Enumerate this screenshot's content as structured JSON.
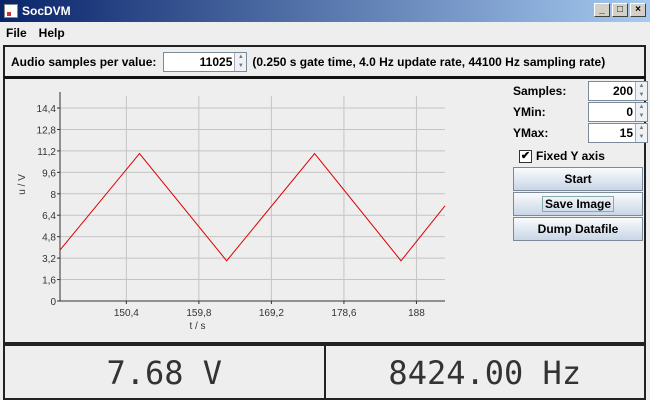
{
  "window": {
    "title": "SocDVM"
  },
  "menu": [
    "File",
    "Help"
  ],
  "top": {
    "label": "Audio samples per value:",
    "value": "11025",
    "info": "(0.250 s gate time, 4.0 Hz update rate, 44100 Hz sampling rate)"
  },
  "side": {
    "samples_label": "Samples:",
    "samples": "200",
    "ymin_label": "YMin:",
    "ymin": "0",
    "ymax_label": "YMax:",
    "ymax": "15",
    "fixed_label": "Fixed Y axis",
    "fixed_checked": true,
    "start": "Start",
    "save": "Save Image",
    "dump": "Dump Datafile"
  },
  "display": {
    "voltage": "7.68 V",
    "frequency": "8424.00 Hz"
  },
  "chart_data": {
    "type": "line",
    "xlabel": "t / s",
    "ylabel": "u / V",
    "xlim": [
      141.8,
      191.7
    ],
    "ylim": [
      0,
      15
    ],
    "xticks": [
      "150,4",
      "159,8",
      "169,2",
      "178,6",
      "188"
    ],
    "xtick_values": [
      150.4,
      159.8,
      169.2,
      178.6,
      188
    ],
    "yticks": [
      "0",
      "1,6",
      "3,2",
      "4,8",
      "6,4",
      "8",
      "9,6",
      "11,2",
      "12,8",
      "14,4"
    ],
    "ytick_values": [
      0,
      1.6,
      3.2,
      4.8,
      6.4,
      8,
      9.6,
      11.2,
      12.8,
      14.4
    ],
    "grid": true,
    "color": "#dd0000",
    "x": [
      141.8,
      152.1,
      163.4,
      174.8,
      186.0,
      191.7
    ],
    "y": [
      3.8,
      11.0,
      3.0,
      11.0,
      3.0,
      7.1
    ]
  }
}
